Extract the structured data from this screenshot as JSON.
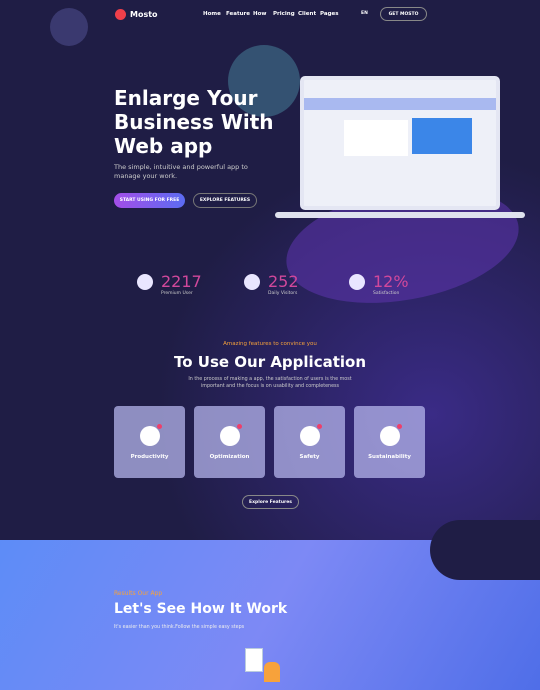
{
  "brand": {
    "name": "Mosto"
  },
  "nav": {
    "items": [
      "Home",
      "Feature",
      "How",
      "Pricing",
      "Client",
      "Pages"
    ],
    "lang": "EN",
    "cta": "GET MOSTO"
  },
  "hero": {
    "title_lines": [
      "Enlarge Your",
      "Business With",
      "Web app"
    ],
    "subtitle": "The simple, intuitive and powerful app to manage your work.",
    "primary": "START USING FOR FREE",
    "secondary": "EXPLORE FEATURES"
  },
  "stats": [
    {
      "value": "2217",
      "label": "Premium User",
      "icon": "user-icon"
    },
    {
      "value": "252",
      "label": "Daily Visitors",
      "icon": "chip-icon"
    },
    {
      "value": "12%",
      "label": "Satisfaction",
      "icon": "smile-icon"
    }
  ],
  "features": {
    "eyebrow": "Amazing features to convince you",
    "title": "To Use Our Application",
    "desc": "In the process of making a app, the satisfaction of users is the most important and the focus is on usability and completeness",
    "cards": [
      "Productivity",
      "Optimization",
      "Safety",
      "Sustainability"
    ],
    "button": "Explore Features"
  },
  "how": {
    "eyebrow": "Results Our App",
    "title": "Let's See How It Work",
    "desc": "It's easier than you think.Follow the simple easy steps"
  },
  "colors": {
    "bg": "#1f1d45",
    "accent": "#d1489b",
    "orange": "#f7a23b"
  }
}
